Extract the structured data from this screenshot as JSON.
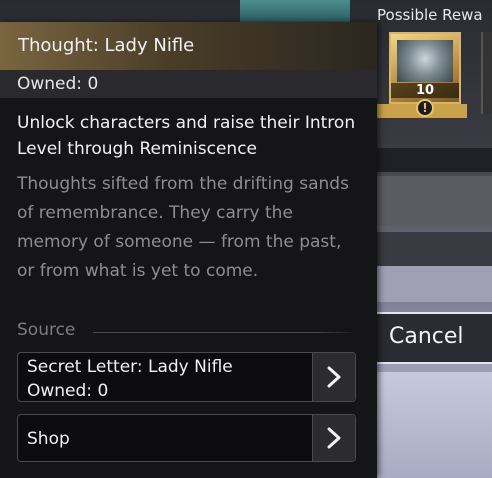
{
  "reward": {
    "title": "Possible Rewa",
    "quantity": "10",
    "info": "!"
  },
  "tooltip": {
    "title": "Thought: Lady Nifle",
    "owned": "Owned: 0",
    "description": "Unlock characters and raise their Intron Level through Reminiscence",
    "flavor": "Thoughts sifted from the drifting sands of remembrance. They carry the memory of someone — from the past, or from what is yet to come.",
    "source_label": "Source",
    "sources": [
      {
        "line1": "Secret Letter: Lady Nifle",
        "line2": "Owned: 0"
      },
      {
        "line1": "Shop"
      }
    ]
  },
  "buttons": {
    "cancel": "Cancel"
  },
  "icons": {
    "source_arrow": "chevron-right-icon",
    "reward_info": "exclamation-icon"
  }
}
